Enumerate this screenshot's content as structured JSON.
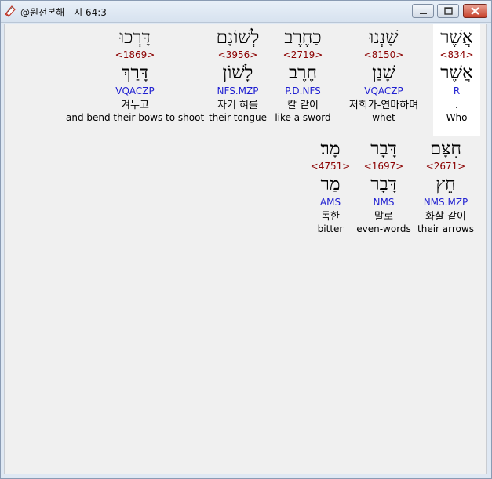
{
  "window": {
    "title": "@원전본해 - 시 64:3",
    "buttons": {
      "minimize": "minimize",
      "maximize": "maximize",
      "close": "close"
    }
  },
  "icons": {
    "app": "bible-book-icon"
  },
  "rows": [
    {
      "words": [
        {
          "hebrew": "אֲשֶׁר",
          "strong": "<834>",
          "lemma": "אֲשֶׁר",
          "morph": "R",
          "korean": ".",
          "english": "Who",
          "selected": true
        },
        {
          "hebrew": "שָׁנְנוּ",
          "strong": "<8150>",
          "lemma": "שָׁנַן",
          "morph": "VQACZP",
          "korean": "저희가-연마하며",
          "english": "whet"
        },
        {
          "hebrew": "כַחֶרֶב",
          "strong": "<2719>",
          "lemma": "חֶרֶב",
          "morph": "P.D.NFS",
          "korean": "칼 같이",
          "english": "like a sword"
        },
        {
          "hebrew": "לְשׁוֹנָם",
          "strong": "<3956>",
          "lemma": "לָשׁוֹן",
          "morph": "NFS.MZP",
          "korean": "자기 혀를",
          "english": "their tongue"
        },
        {
          "hebrew": "דָּרְכוּ",
          "strong": "<1869>",
          "lemma": "דָּרַךְ",
          "morph": "VQACZP",
          "korean": "겨누고",
          "english": "and bend their bows to shoot"
        }
      ]
    },
    {
      "words": [
        {
          "hebrew": "חִצָּם",
          "strong": "<2671>",
          "lemma": "חֵץ",
          "morph": "NMS.MZP",
          "korean": "화살 같이",
          "english": "their arrows"
        },
        {
          "hebrew": "דָּבָר",
          "strong": "<1697>",
          "lemma": "דָּבָר",
          "morph": "NMS",
          "korean": "말로",
          "english": "even-words"
        },
        {
          "hebrew": "מָר׃",
          "strong": "<4751>",
          "lemma": "מַר",
          "morph": "AMS",
          "korean": "독한",
          "english": "bitter"
        }
      ]
    }
  ]
}
